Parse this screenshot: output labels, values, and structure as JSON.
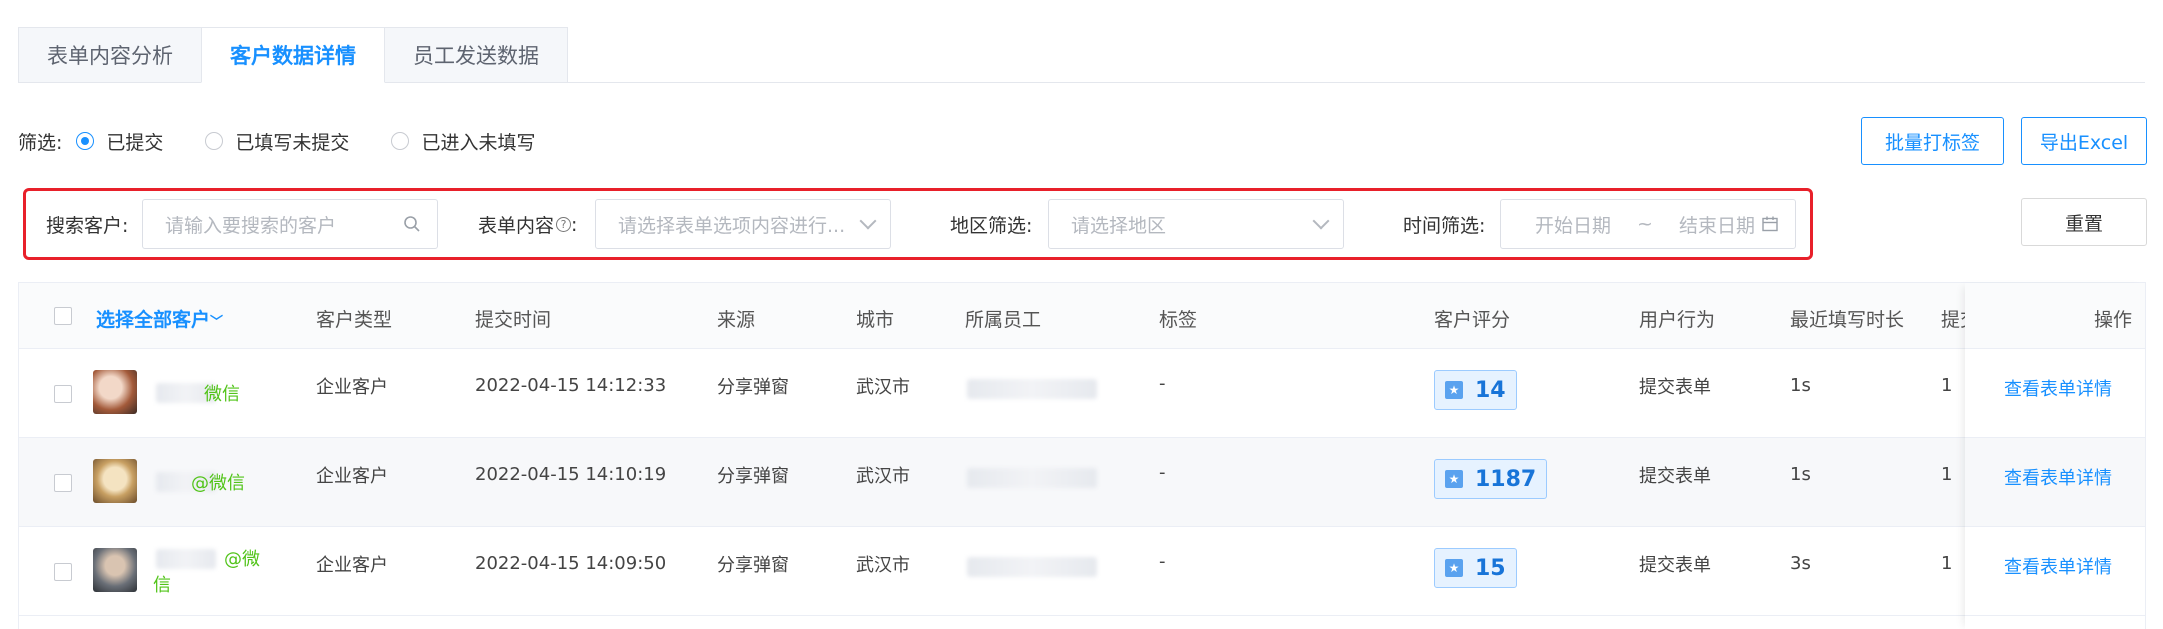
{
  "tabs": [
    {
      "label": "表单内容分析"
    },
    {
      "label": "客户数据详情"
    },
    {
      "label": "员工发送数据"
    }
  ],
  "filter": {
    "label": "筛选:",
    "options": [
      {
        "label": "已提交",
        "checked": true
      },
      {
        "label": "已填写未提交",
        "checked": false
      },
      {
        "label": "已进入未填写",
        "checked": false
      }
    ]
  },
  "actions": {
    "batch_tag": "批量打标签",
    "export_excel": "导出Excel",
    "reset": "重置"
  },
  "search": {
    "customer_label": "搜索客户:",
    "customer_placeholder": "请输入要搜索的客户",
    "form_content_label": "表单内容",
    "form_content_placeholder": "请选择表单选项内容进行...",
    "region_label": "地区筛选:",
    "region_placeholder": "请选择地区",
    "time_label": "时间筛选:",
    "start_placeholder": "开始日期",
    "range_sep": "~",
    "end_placeholder": "结束日期"
  },
  "table": {
    "headers": {
      "select_all": "选择全部客户",
      "customer_type": "客户类型",
      "submit_time": "提交时间",
      "source": "来源",
      "city": "城市",
      "staff": "所属员工",
      "tags": "标签",
      "score": "客户评分",
      "behavior": "用户行为",
      "duration": "最近填写时长",
      "submit_count": "提交",
      "ops": "操作"
    },
    "rows": [
      {
        "name_suffix": "微信",
        "type": "企业客户",
        "time": "2022-04-15 14:12:33",
        "source": "分享弹窗",
        "city": "武汉市",
        "tags": "-",
        "score": "14",
        "behavior": "提交表单",
        "duration": "1s",
        "count": "1",
        "link": "查看表单详情"
      },
      {
        "name_suffix": "@微信",
        "type": "企业客户",
        "time": "2022-04-15 14:10:19",
        "source": "分享弹窗",
        "city": "武汉市",
        "tags": "-",
        "score": "1187",
        "behavior": "提交表单",
        "duration": "1s",
        "count": "1",
        "link": "查看表单详情"
      },
      {
        "name_suffix_a": "@微",
        "name_suffix_b": "信",
        "type": "企业客户",
        "time": "2022-04-15 14:09:50",
        "source": "分享弹窗",
        "city": "武汉市",
        "tags": "-",
        "score": "15",
        "behavior": "提交表单",
        "duration": "3s",
        "count": "1",
        "link": "查看表单详情"
      }
    ]
  },
  "colors": {
    "accent": "#1890ff",
    "highlight_border": "#e8202a",
    "wechat": "#52c41a"
  }
}
